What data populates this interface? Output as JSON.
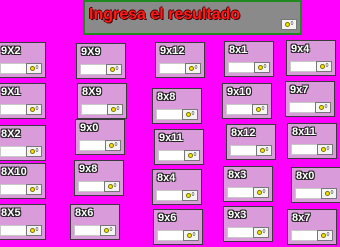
{
  "header": {
    "title": "Ingresa el resultado",
    "score": "0"
  },
  "cards": [
    {
      "label": "9X2",
      "score": "0"
    },
    {
      "label": "9X1",
      "score": "0"
    },
    {
      "label": "8X2",
      "score": "0"
    },
    {
      "label": "8X10",
      "score": "0"
    },
    {
      "label": "8X5",
      "score": "0"
    },
    {
      "label": "9X9",
      "score": "0"
    },
    {
      "label": "8X9",
      "score": "0"
    },
    {
      "label": "9x0",
      "score": "0"
    },
    {
      "label": "9x8",
      "score": "0"
    },
    {
      "label": "8x6",
      "score": "0"
    },
    {
      "label": "9x12",
      "score": "0"
    },
    {
      "label": "8x8",
      "score": "0"
    },
    {
      "label": "9x11",
      "score": "0"
    },
    {
      "label": "8x4",
      "score": "0"
    },
    {
      "label": "9x6",
      "score": "0"
    },
    {
      "label": "8x1",
      "score": "0"
    },
    {
      "label": "9x10",
      "score": "0"
    },
    {
      "label": "8x12",
      "score": "0"
    },
    {
      "label": "8x3",
      "score": "0"
    },
    {
      "label": "9x3",
      "score": "0"
    },
    {
      "label": "9x4",
      "score": "0"
    },
    {
      "label": "9x7",
      "score": "0"
    },
    {
      "label": "8x11",
      "score": "0"
    },
    {
      "label": "8x0",
      "score": "0"
    },
    {
      "label": "8x7",
      "score": "0"
    }
  ]
}
